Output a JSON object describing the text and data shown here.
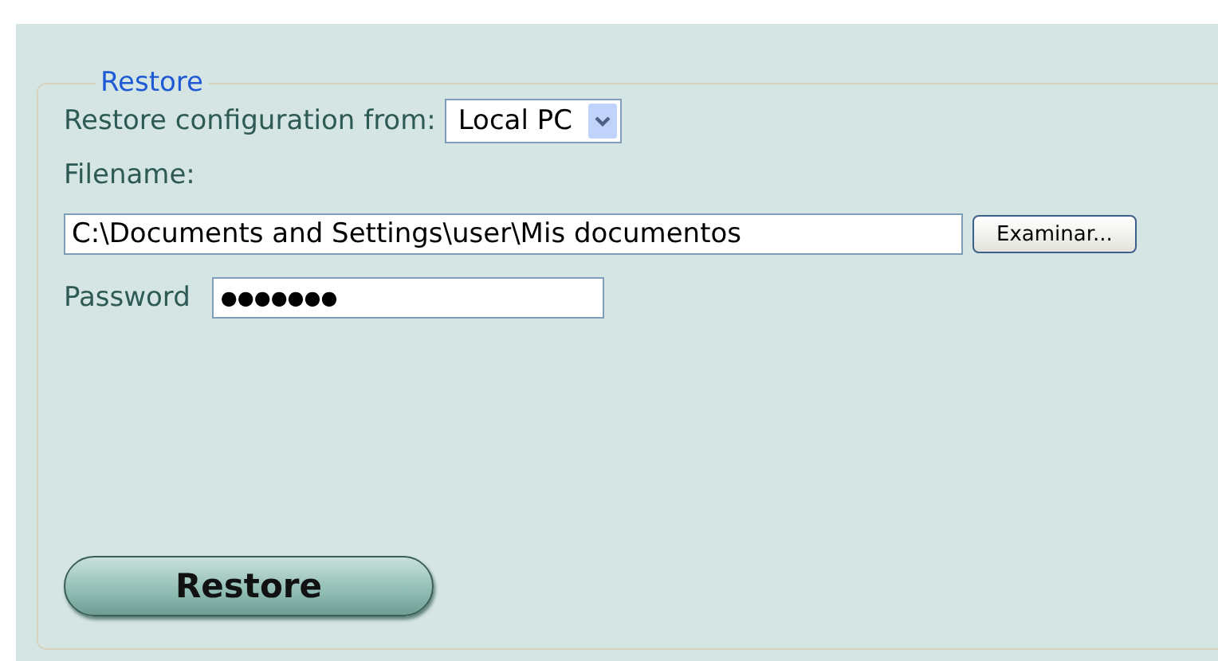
{
  "section": {
    "legend": "Restore"
  },
  "source": {
    "label": "Restore configuration from:",
    "value": "Local PC"
  },
  "filename": {
    "label": "Filename:",
    "value": "C:\\Documents and Settings\\user\\Mis documentos",
    "browse": "Examinar..."
  },
  "password": {
    "label": "Password",
    "masked": "●●●●●●●"
  },
  "action": {
    "label": "Restore"
  }
}
